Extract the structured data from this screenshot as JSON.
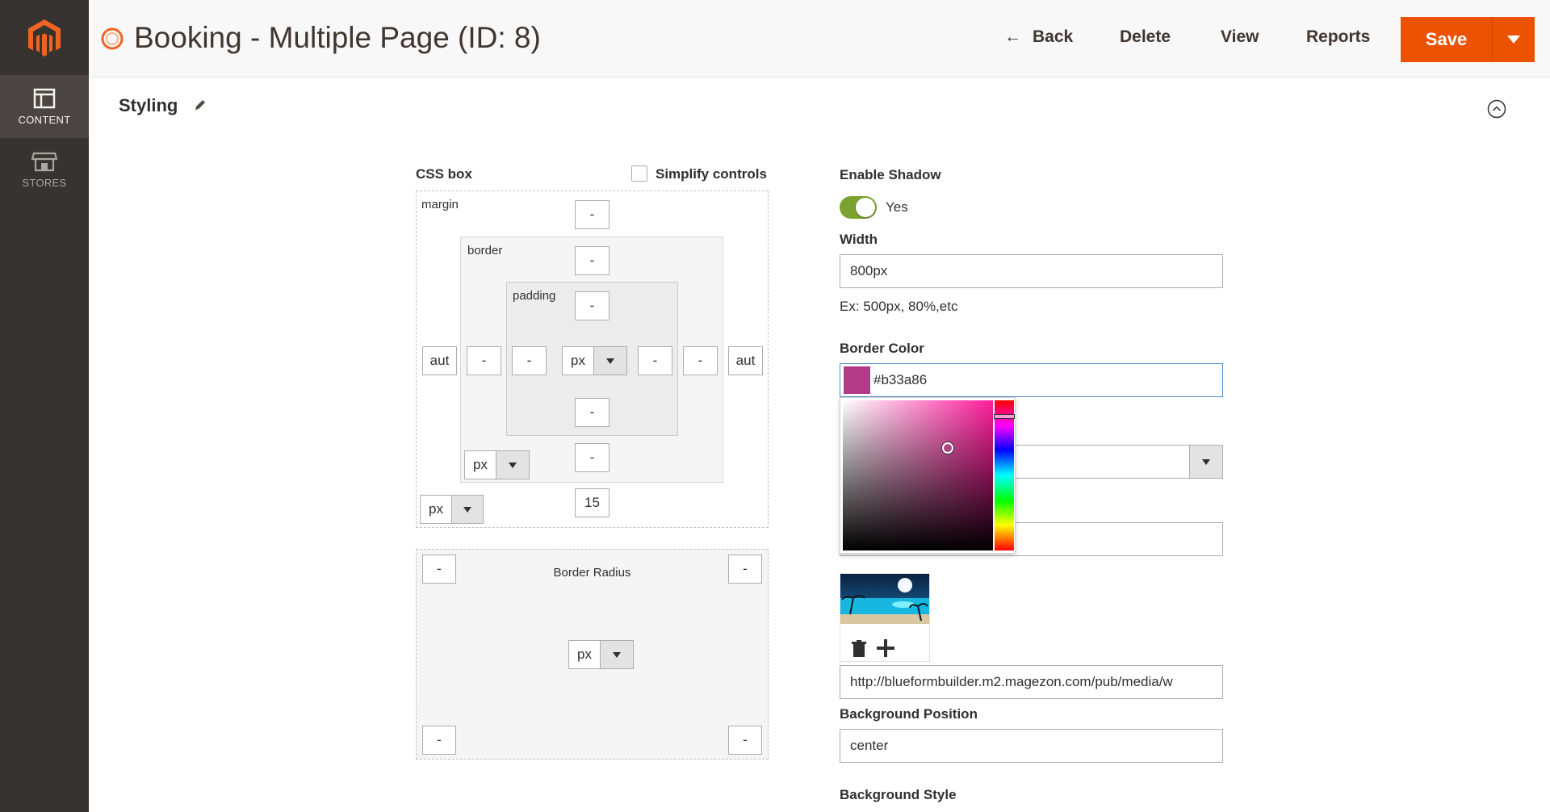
{
  "sidebar": {
    "items": [
      {
        "label": "CONTENT",
        "icon": "layout-icon"
      },
      {
        "label": "STORES",
        "icon": "store-icon"
      }
    ]
  },
  "header": {
    "title": "Booking - Multiple Page (ID: 8)",
    "back_label": "Back",
    "delete_label": "Delete",
    "view_label": "View",
    "reports_label": "Reports",
    "save_label": "Save"
  },
  "section": {
    "title": "Styling"
  },
  "css_box": {
    "title": "CSS box",
    "simplify_label": "Simplify controls",
    "simplify_checked": false,
    "margin_label": "margin",
    "border_label": "border",
    "padding_label": "padding",
    "margin": {
      "top": "-",
      "left": "aut",
      "right": "aut",
      "bottom": "15",
      "unit": "px"
    },
    "border": {
      "top": "-",
      "left": "-",
      "right": "-",
      "bottom": "-",
      "unit": "px"
    },
    "padding": {
      "top": "-",
      "left": "-",
      "right": "-",
      "bottom": "-",
      "unit": "px"
    }
  },
  "border_radius": {
    "label": "Border Radius",
    "top_left": "-",
    "top_right": "-",
    "bottom_left": "-",
    "bottom_right": "-",
    "unit": "px"
  },
  "form": {
    "shadow_label": "Enable Shadow",
    "shadow_value": "Yes",
    "width_label": "Width",
    "width_value": "800px",
    "width_note": "Ex: 500px, 80%,etc",
    "border_color_label": "Border Color",
    "border_color_value": "#b33a86",
    "border_color_swatch": "#b33a86",
    "bg_image_url": "http://blueformbuilder.m2.magezon.com/pub/media/w",
    "bg_position_label": "Background Position",
    "bg_position_value": "center",
    "bg_style_label": "Background Style"
  },
  "colors": {
    "accent": "#eb5202",
    "sidebar": "#373330",
    "toggle_on": "#79a22e"
  }
}
